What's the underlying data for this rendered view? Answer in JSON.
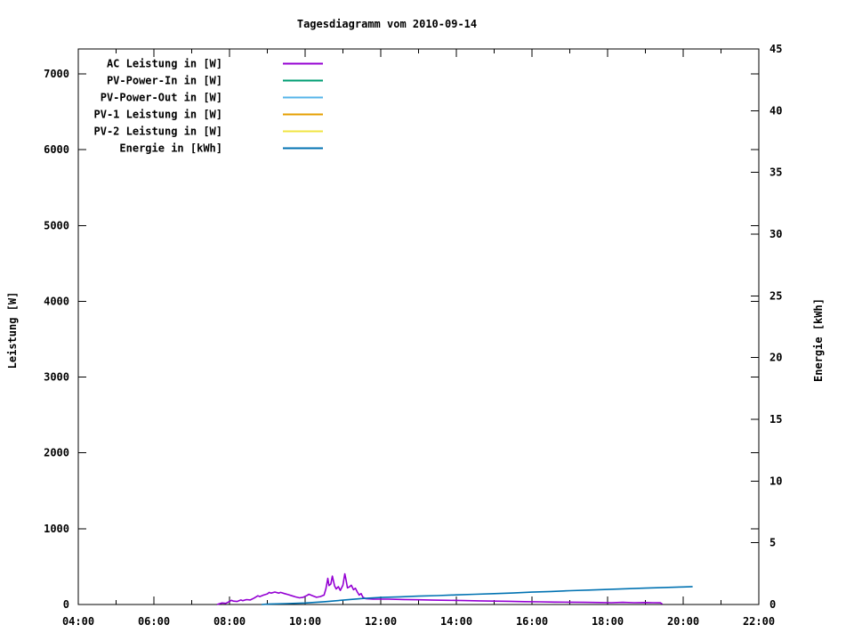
{
  "title": "Tagesdiagramm vom 2010-09-14",
  "y_axis_label": "Leistung [W]",
  "y2_axis_label": "Energie [kWh]",
  "chart_data": {
    "type": "line",
    "title": "Tagesdiagramm vom 2010-09-14",
    "grid": false,
    "legend_position": "top-left-inside",
    "x_axis": {
      "range_hours": [
        4,
        22
      ],
      "major_tick_step_hours": 2,
      "minor_tick_step_hours": 1,
      "tick_labels": [
        "04:00",
        "06:00",
        "08:00",
        "10:00",
        "12:00",
        "14:00",
        "16:00",
        "18:00",
        "20:00",
        "22:00"
      ]
    },
    "y_axis": {
      "label": "Leistung [W]",
      "range": [
        0,
        7000
      ],
      "tick_step": 1000,
      "tick_labels": [
        "0",
        "1000",
        "2000",
        "3000",
        "4000",
        "5000",
        "6000",
        "7000"
      ]
    },
    "y2_axis": {
      "label": "Energie [kWh]",
      "range": [
        0,
        45
      ],
      "tick_step": 5,
      "tick_labels": [
        "0",
        "5",
        "10",
        "15",
        "20",
        "25",
        "30",
        "35",
        "40",
        "45"
      ]
    },
    "series": [
      {
        "name": "AC Leistung in [W]",
        "color": "#9400D3",
        "axis": "y1",
        "points": [
          [
            7.67,
            0
          ],
          [
            7.8,
            20
          ],
          [
            7.9,
            15
          ],
          [
            8.0,
            40
          ],
          [
            8.05,
            55
          ],
          [
            8.1,
            45
          ],
          [
            8.2,
            40
          ],
          [
            8.3,
            60
          ],
          [
            8.35,
            50
          ],
          [
            8.45,
            65
          ],
          [
            8.55,
            60
          ],
          [
            8.65,
            85
          ],
          [
            8.75,
            115
          ],
          [
            8.8,
            105
          ],
          [
            8.9,
            125
          ],
          [
            9.0,
            140
          ],
          [
            9.05,
            160
          ],
          [
            9.1,
            150
          ],
          [
            9.2,
            165
          ],
          [
            9.3,
            150
          ],
          [
            9.35,
            160
          ],
          [
            9.45,
            145
          ],
          [
            9.55,
            130
          ],
          [
            9.65,
            115
          ],
          [
            9.75,
            100
          ],
          [
            9.85,
            88
          ],
          [
            9.95,
            95
          ],
          [
            10.05,
            120
          ],
          [
            10.1,
            135
          ],
          [
            10.2,
            115
          ],
          [
            10.3,
            95
          ],
          [
            10.4,
            105
          ],
          [
            10.5,
            125
          ],
          [
            10.55,
            210
          ],
          [
            10.6,
            345
          ],
          [
            10.63,
            250
          ],
          [
            10.68,
            270
          ],
          [
            10.72,
            375
          ],
          [
            10.78,
            245
          ],
          [
            10.82,
            205
          ],
          [
            10.88,
            235
          ],
          [
            10.93,
            185
          ],
          [
            11.0,
            255
          ],
          [
            11.05,
            405
          ],
          [
            11.08,
            330
          ],
          [
            11.12,
            220
          ],
          [
            11.18,
            235
          ],
          [
            11.22,
            255
          ],
          [
            11.28,
            195
          ],
          [
            11.33,
            215
          ],
          [
            11.38,
            165
          ],
          [
            11.43,
            125
          ],
          [
            11.48,
            145
          ],
          [
            11.53,
            95
          ],
          [
            11.6,
            78
          ],
          [
            11.8,
            72
          ],
          [
            12.2,
            70
          ],
          [
            12.6,
            66
          ],
          [
            13.0,
            62
          ],
          [
            13.4,
            58
          ],
          [
            13.8,
            55
          ],
          [
            14.2,
            52
          ],
          [
            14.6,
            48
          ],
          [
            15.0,
            45
          ],
          [
            15.4,
            42
          ],
          [
            15.8,
            38
          ],
          [
            16.2,
            35
          ],
          [
            16.6,
            32
          ],
          [
            17.0,
            30
          ],
          [
            17.4,
            28
          ],
          [
            17.8,
            26
          ],
          [
            18.1,
            24
          ],
          [
            18.4,
            28
          ],
          [
            18.7,
            24
          ],
          [
            19.0,
            26
          ],
          [
            19.2,
            24
          ],
          [
            19.4,
            22
          ],
          [
            19.45,
            5
          ]
        ]
      },
      {
        "name": "PV-Power-In in [W]",
        "color": "#009E73",
        "axis": "y1",
        "points": []
      },
      {
        "name": "PV-Power-Out in [W]",
        "color": "#56B4E9",
        "axis": "y1",
        "points": []
      },
      {
        "name": "PV-1 Leistung in [W]",
        "color": "#E69F00",
        "axis": "y1",
        "points": []
      },
      {
        "name": "PV-2 Leistung in [W]",
        "color": "#F0E442",
        "axis": "y1",
        "points": []
      },
      {
        "name": "Energie in [kWh]",
        "color": "#0072B2",
        "axis": "y2",
        "points": [
          [
            8.85,
            0.0
          ],
          [
            9.0,
            0.03
          ],
          [
            9.5,
            0.07
          ],
          [
            10.0,
            0.12
          ],
          [
            10.5,
            0.22
          ],
          [
            11.0,
            0.35
          ],
          [
            11.5,
            0.48
          ],
          [
            12.0,
            0.57
          ],
          [
            12.5,
            0.62
          ],
          [
            13.0,
            0.68
          ],
          [
            13.5,
            0.72
          ],
          [
            14.0,
            0.78
          ],
          [
            14.5,
            0.83
          ],
          [
            15.0,
            0.88
          ],
          [
            15.5,
            0.93
          ],
          [
            16.0,
            1.0
          ],
          [
            16.5,
            1.05
          ],
          [
            17.0,
            1.12
          ],
          [
            17.5,
            1.17
          ],
          [
            18.0,
            1.22
          ],
          [
            18.5,
            1.28
          ],
          [
            19.0,
            1.33
          ],
          [
            19.5,
            1.38
          ],
          [
            20.0,
            1.42
          ],
          [
            20.25,
            1.45
          ]
        ]
      }
    ]
  }
}
